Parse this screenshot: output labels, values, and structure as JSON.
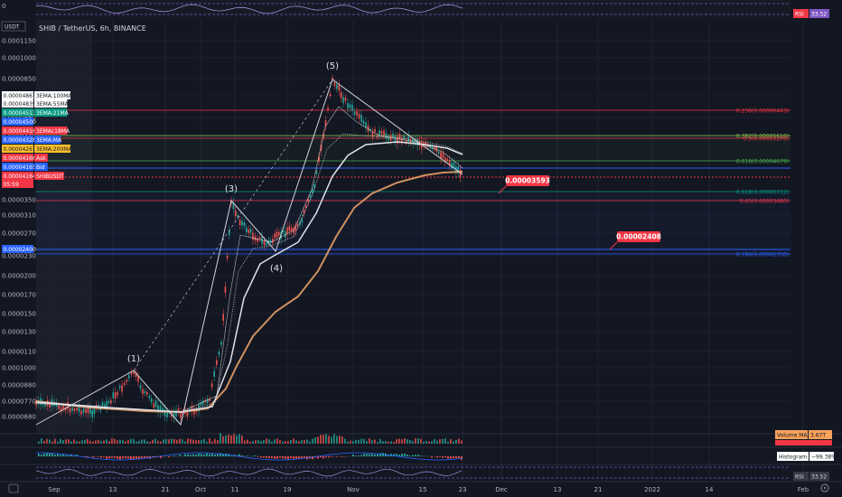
{
  "chart_data": {
    "type": "line",
    "title": "SHIB / TetherUS, 6h, BINANCE",
    "currency_tag": "USDT",
    "y_scale": "log",
    "ylim": [
      6.4e-06,
      1.25e-05
    ],
    "y_ticks": [
      {
        "value": 1.15e-05,
        "label": "0.0001150"
      },
      {
        "value": 1e-05,
        "label": "0.0001000"
      },
      {
        "value": 8.5e-06,
        "label": "0.0000850"
      },
      {
        "value": 7e-06,
        "label": "0.0000700"
      },
      {
        "value": 5.6e-06,
        "label": "0.0000560"
      },
      {
        "value": 4.4e-06,
        "label": "0.0000440"
      },
      {
        "value": 3.5e-06,
        "label": "0.0000350"
      },
      {
        "value": 3.1e-06,
        "label": "0.0000310"
      },
      {
        "value": 2.7e-06,
        "label": "0.0000270"
      },
      {
        "value": 2.3e-06,
        "label": "0.0000230"
      },
      {
        "value": 2e-06,
        "label": "0.0000200"
      },
      {
        "value": 1.7e-06,
        "label": "0.0000170"
      },
      {
        "value": 1.5e-06,
        "label": "0.0000150"
      },
      {
        "value": 1.3e-06,
        "label": "0.0000130"
      },
      {
        "value": 1.1e-06,
        "label": "0.0000110"
      },
      {
        "value": 1e-06,
        "label": "0.0001000"
      },
      {
        "value": 8.8e-07,
        "label": "0.0000880"
      },
      {
        "value": 7.7e-07,
        "label": "0.0000770"
      },
      {
        "value": 6.8e-07,
        "label": "0.0000680"
      }
    ],
    "x_ticks": [
      "Sep",
      "13",
      "21",
      "Oct",
      "11",
      "19",
      "Nov",
      "15",
      "23",
      "Dec",
      "13",
      "21",
      "2022",
      "14",
      "Feb"
    ],
    "price_tags": [
      {
        "label": "0.00004867",
        "name": "3EMA:100MA",
        "color": "#ffffff",
        "text_color": "#131722"
      },
      {
        "label": "0.00004839",
        "name": "3EMA:55MA",
        "color": "#ffffff",
        "text_color": "#131722"
      },
      {
        "label": "0.00004513",
        "name": "3EMA:21MA",
        "color": "#089981",
        "text_color": "#ffffff"
      },
      {
        "label": "0.00004500",
        "name": "",
        "color": "#2962ff",
        "text_color": "#ffffff"
      },
      {
        "label": "0.00004416",
        "name": "3EMAc18MA",
        "color": "#f23645",
        "text_color": "#ffffff"
      },
      {
        "label": "0.00004328",
        "name": "3EMA:MA",
        "color": "#2962ff",
        "text_color": "#ffffff"
      },
      {
        "label": "0.00004267",
        "name": "3EMA:200MA",
        "color": "#fbc02d",
        "text_color": "#131722"
      },
      {
        "label": "0.00004166",
        "name": "Ask",
        "color": "#f23645",
        "text_color": "#ffffff"
      },
      {
        "label": "0.00004165",
        "name": "Bid",
        "color": "#2962ff",
        "text_color": "#ffffff"
      },
      {
        "label": "0.00004164",
        "name": "SHIBUSDT",
        "color": "#f23645",
        "text_color": "#ffffff"
      },
      {
        "label": "05:59",
        "name": "",
        "color": "#f23645",
        "text_color": "#ffffff"
      }
    ],
    "level_tag": {
      "label": "0.00002400",
      "color": "#2962ff"
    },
    "fib_levels": [
      {
        "ratio": 0.236,
        "label": "0.236(0.00006443)",
        "color": "#f23645",
        "value": 6.443e-05
      },
      {
        "ratio": 0.382,
        "label": "0.382(0.00005616)",
        "color": "#8bc34a",
        "value": 5.616e-05
      },
      {
        "ratio": 0.5,
        "label": "0.5(0.00005270)",
        "color": "#f23645",
        "value": 5.27e-05
      },
      {
        "ratio": 0.618,
        "label": "0.618(0.00004679)",
        "color": "#4caf50",
        "value": 4.679e-05
      },
      {
        "ratio": 0.618,
        "label": "0.618(0.00003712)",
        "color": "#089981",
        "value": 3.712e-05
      },
      {
        "ratio": 0.65,
        "label": "0.65(0.00003480)",
        "color": "#f23645",
        "value": 3.48e-05
      },
      {
        "ratio": 0.786,
        "label": "0.786(0.00002356)",
        "color": "#2962ff",
        "value": 2.356e-05
      }
    ],
    "callouts": [
      {
        "label": "0.00003593",
        "value": 3.593e-05
      },
      {
        "label": "0.00002408",
        "value": 2.408e-05
      }
    ],
    "wave_labels": [
      "(1)",
      "(3)",
      "(4)",
      "(5)"
    ],
    "price_series_approx": [
      7.4e-06,
      7.3e-06,
      7.2e-06,
      7.1e-06,
      7.2e-06,
      8.1e-06,
      9.5e-06,
      8e-06,
      7.2e-06,
      7e-06,
      7e-06,
      7.1e-06,
      7.5e-06,
      1.1e-05,
      3.35e-05,
      2.9e-05,
      2.65e-05,
      2.4e-05,
      2.75e-05,
      2.9e-05,
      4.5e-05,
      7e-05,
      8.7e-05,
      7e-05,
      6e-05,
      5.4e-05,
      5e-05,
      4.7e-05,
      4.4e-05,
      4.17e-05
    ],
    "indicators": {
      "volume": {
        "label": "Volume MA",
        "value": "3.67T"
      },
      "histogram": {
        "label": "Histogram",
        "value": "−99.38%"
      },
      "rsi_top": {
        "label": "RSI",
        "value": "33.52"
      },
      "rsi_bottom": {
        "label": "RSI",
        "value": "33.52"
      }
    }
  }
}
